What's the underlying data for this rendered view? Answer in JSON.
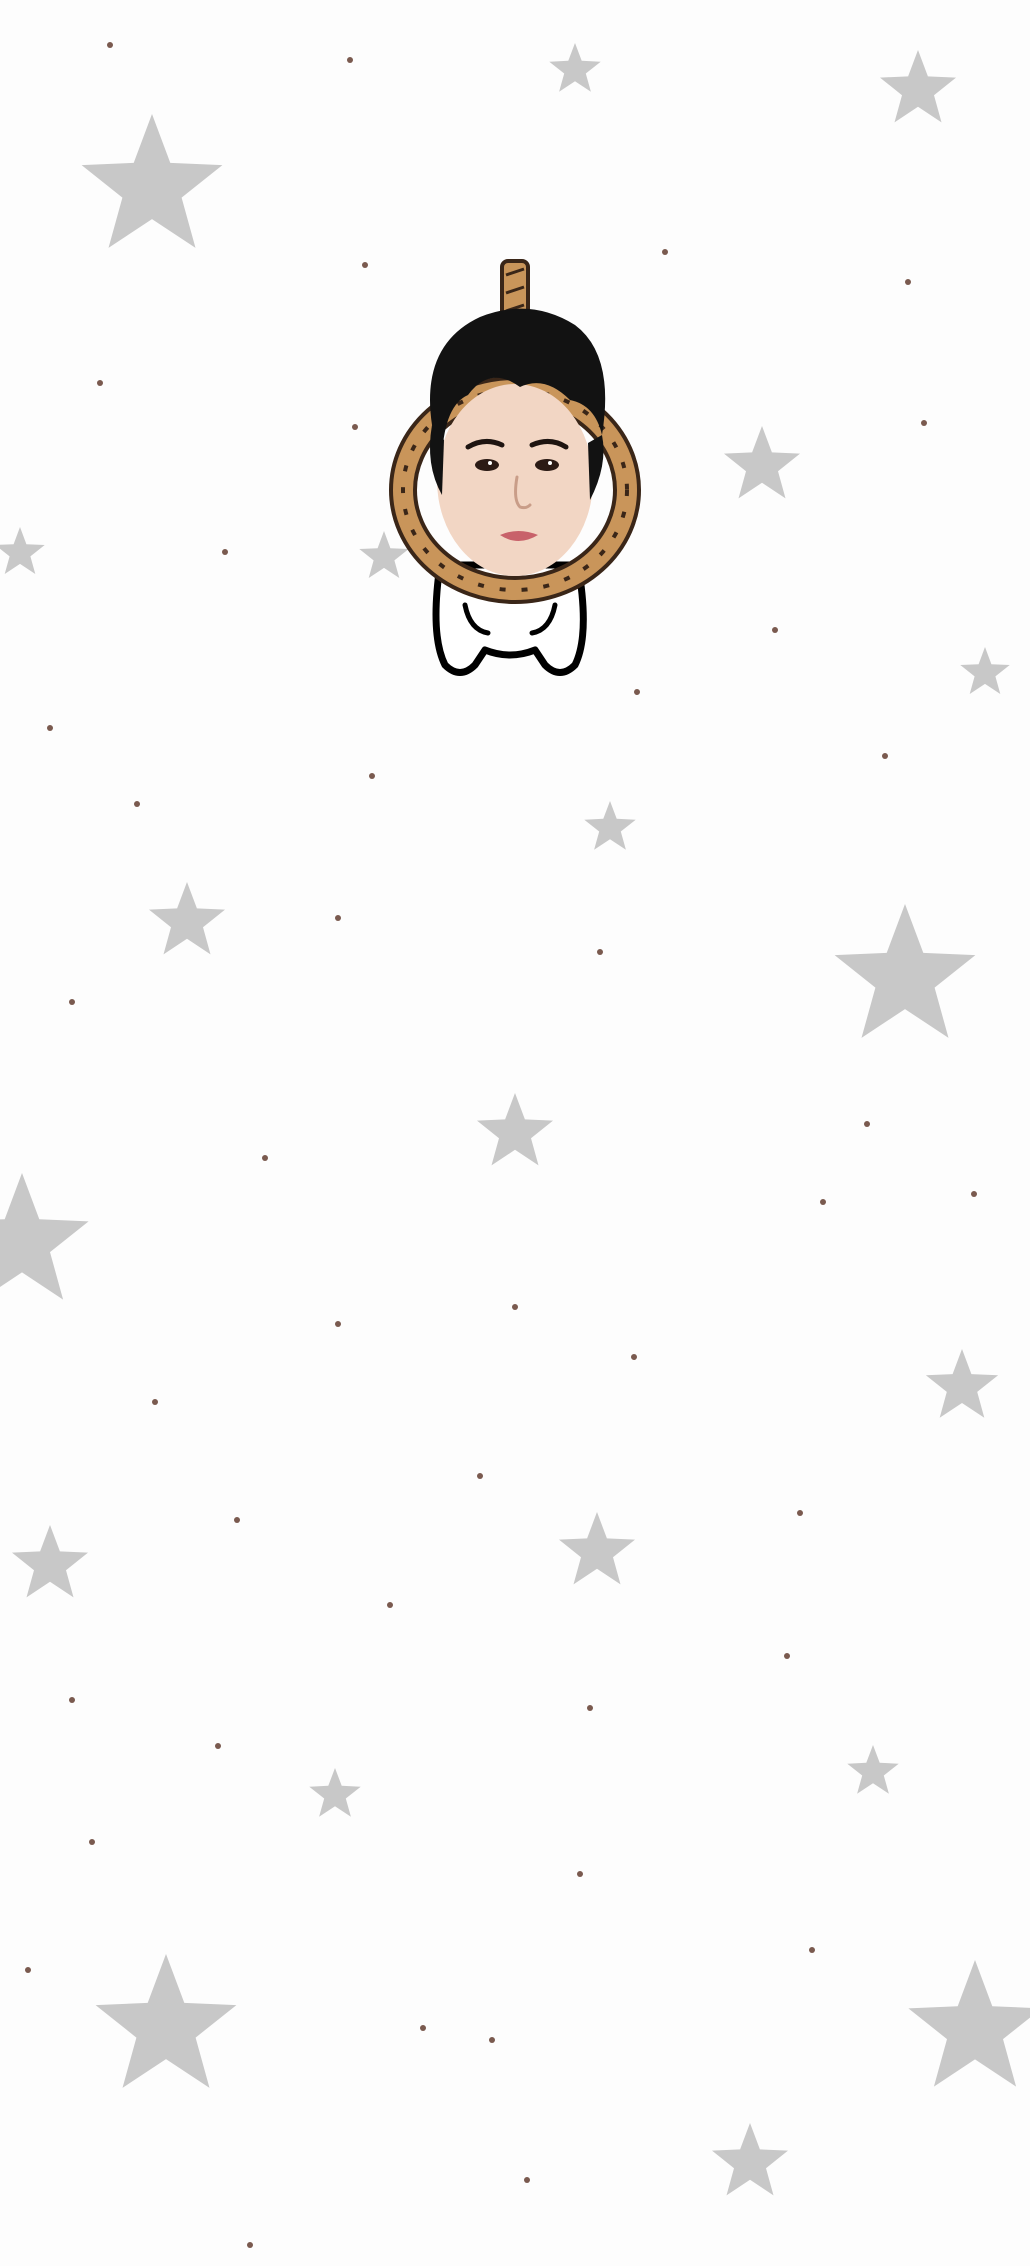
{
  "wallpaper": {
    "background_color": "#fdfdfd",
    "star_color": "#c8c8c8",
    "dot_color": "#7a5a4f",
    "star_icon": "star-icon",
    "dot_icon": "dot-icon"
  },
  "character": {
    "head_icon": "cartoon-face-icon",
    "hair_color": "#121212",
    "skin_color": "#f2d6c4",
    "rope_color": "#c9955a",
    "rope_outline_color": "#3a2618",
    "body_color": "#ffffff",
    "body_outline_color": "#000000"
  }
}
